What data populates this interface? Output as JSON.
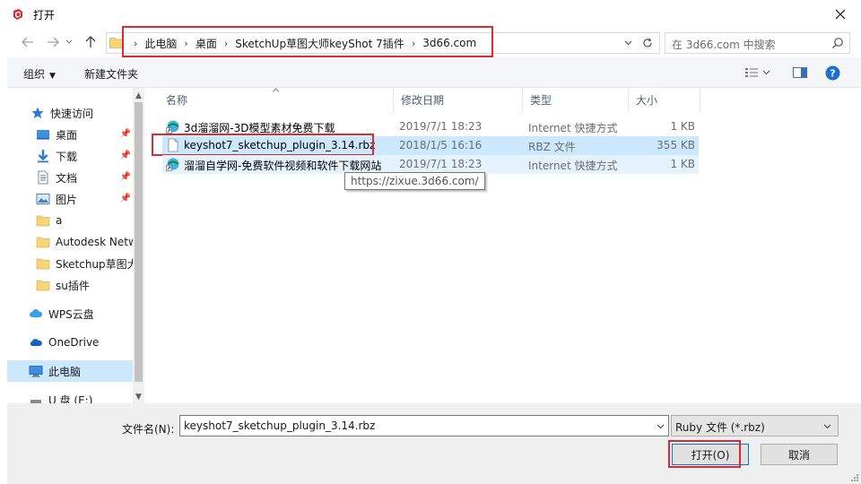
{
  "window": {
    "title": "打开"
  },
  "address": {
    "crumbs": [
      "此电脑",
      "桌面",
      "SketchUp草图大师keyShot 7插件",
      "3d66.com"
    ]
  },
  "search": {
    "placeholder": "在 3d66.com 中搜索"
  },
  "toolbar": {
    "organize_label": "组织",
    "new_folder_label": "新建文件夹"
  },
  "sidebar": {
    "items": [
      {
        "label": "快速访问",
        "icon": "star-icon"
      },
      {
        "label": "桌面",
        "icon": "desktop-icon",
        "pinned": true
      },
      {
        "label": "下载",
        "icon": "download-icon",
        "pinned": true
      },
      {
        "label": "文档",
        "icon": "document-icon",
        "pinned": true
      },
      {
        "label": "图片",
        "icon": "picture-icon",
        "pinned": true
      },
      {
        "label": "a",
        "icon": "folder-icon"
      },
      {
        "label": "Autodesk Netw",
        "icon": "folder-icon"
      },
      {
        "label": "Sketchup草图大",
        "icon": "folder-icon"
      },
      {
        "label": "su插件",
        "icon": "folder-icon"
      },
      {
        "label": "WPS云盘",
        "icon": "cloud-icon"
      },
      {
        "label": "OneDrive",
        "icon": "onedrive-icon"
      },
      {
        "label": "此电脑",
        "icon": "computer-icon",
        "selected": true
      },
      {
        "label": "U 盘 (E:)",
        "icon": "usb-drive-icon"
      }
    ]
  },
  "columns": {
    "name": "名称",
    "date": "修改日期",
    "type": "类型",
    "size": "大小"
  },
  "files": [
    {
      "name": "3d溜溜网-3D模型素材免费下载",
      "date": "2019/7/1 18:23",
      "type": "Internet 快捷方式",
      "size": "1 KB",
      "icon": "internet-shortcut-icon"
    },
    {
      "name": "keyshot7_sketchup_plugin_3.14.rbz",
      "date": "2018/1/5 16:16",
      "type": "RBZ 文件",
      "size": "355 KB",
      "icon": "file-icon",
      "selected": true
    },
    {
      "name": "溜溜自学网-免费软件视频和软件下载网站",
      "date": "2019/7/1 18:23",
      "type": "Internet 快捷方式",
      "size": "1 KB",
      "icon": "internet-shortcut-icon"
    }
  ],
  "tooltip": {
    "text": "https://zixue.3d66.com/"
  },
  "footer": {
    "filename_label": "文件名(N):",
    "filename_value": "keyshot7_sketchup_plugin_3.14.rbz",
    "filter_value": "Ruby 文件 (*.rbz)",
    "open_label": "打开(O)",
    "cancel_label": "取消"
  },
  "colors": {
    "highlight": "#e0282e",
    "selection": "#cce8ff",
    "accent": "#0078d7"
  }
}
